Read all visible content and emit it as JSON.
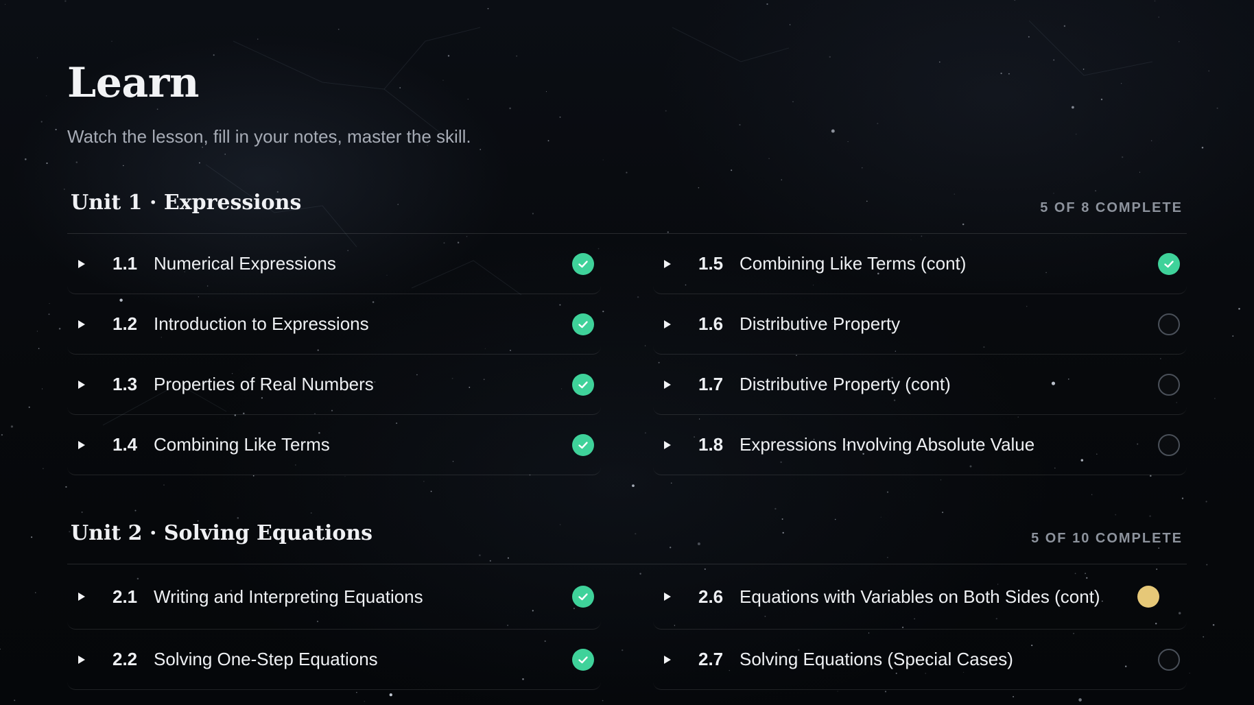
{
  "page": {
    "title": "Learn",
    "subtitle": "Watch the lesson, fill in your notes, master the skill."
  },
  "colors": {
    "complete": "#3fd29a",
    "in_progress": "#e6c878",
    "not_started_ring": "#4a5059"
  },
  "units": [
    {
      "title": "Unit 1 · Expressions",
      "progress": "5 OF 8 COMPLETE",
      "lessons": [
        {
          "number": "1.1",
          "name": "Numerical Expressions",
          "status": "complete"
        },
        {
          "number": "1.5",
          "name": "Combining Like Terms (cont)",
          "status": "complete"
        },
        {
          "number": "1.2",
          "name": "Introduction to Expressions",
          "status": "complete"
        },
        {
          "number": "1.6",
          "name": "Distributive Property",
          "status": "not-started"
        },
        {
          "number": "1.3",
          "name": "Properties of Real Numbers",
          "status": "complete"
        },
        {
          "number": "1.7",
          "name": "Distributive Property (cont)",
          "status": "not-started"
        },
        {
          "number": "1.4",
          "name": "Combining Like Terms",
          "status": "complete"
        },
        {
          "number": "1.8",
          "name": "Expressions Involving Absolute Value",
          "status": "not-started"
        }
      ]
    },
    {
      "title": "Unit 2 · Solving Equations",
      "progress": "5 OF 10 COMPLETE",
      "lessons": [
        {
          "number": "2.1",
          "name": "Writing and Interpreting Equations",
          "status": "complete"
        },
        {
          "number": "2.6",
          "name": "Equations with Variables on Both Sides (cont)",
          "status": "in-progress"
        },
        {
          "number": "2.2",
          "name": "Solving One-Step Equations",
          "status": "complete"
        },
        {
          "number": "2.7",
          "name": "Solving Equations (Special Cases)",
          "status": "not-started"
        }
      ]
    }
  ]
}
